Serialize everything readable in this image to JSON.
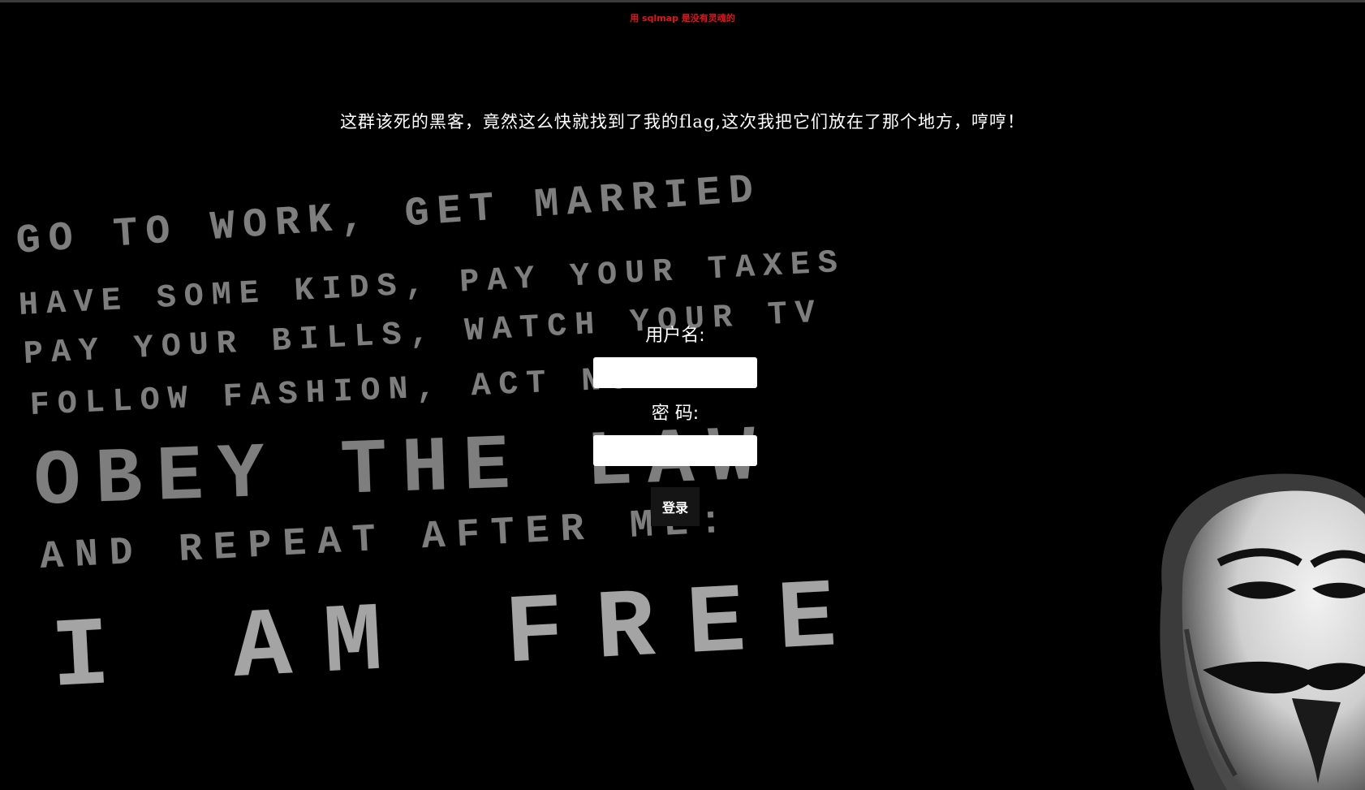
{
  "banner": "用 sqlmap 是没有灵魂的",
  "taunt": "这群该死的黑客，竟然这么快就找到了我的flag,这次我把它们放在了那个地方，哼哼！",
  "background_text": {
    "line1": "GO TO WORK, GET MARRIED",
    "line2": "HAVE SOME KIDS, PAY YOUR TAXES",
    "line3": "PAY YOUR BILLS, WATCH YOUR TV",
    "line4": "FOLLOW FASHION, ACT NORMAL",
    "line5": "OBEY THE LAW",
    "line6": "AND REPEAT AFTER ME:",
    "line7": "I AM FREE"
  },
  "form": {
    "username_label": "用户名:",
    "username_value": "",
    "password_label": "密 码:",
    "password_value": "",
    "login_label": "登录"
  },
  "colors": {
    "background": "#000000",
    "banner_text": "#e0151b",
    "text": "#ffffff",
    "button_bg": "#151515"
  },
  "icons": {
    "mask": "guy-fawkes-mask-icon"
  }
}
